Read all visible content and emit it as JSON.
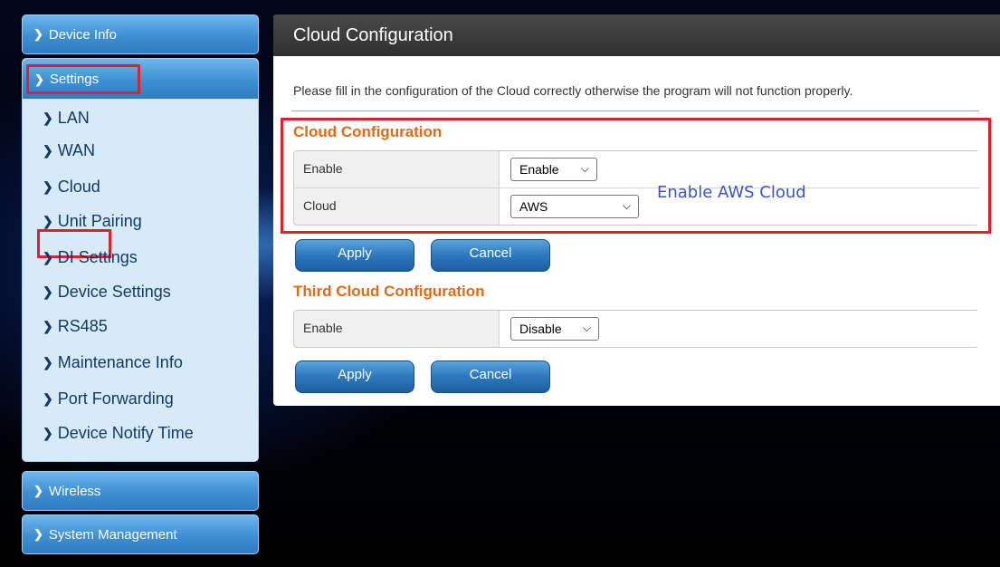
{
  "sidebar": {
    "device_info": "Device Info",
    "settings": "Settings",
    "settings_items": [
      "LAN",
      "WAN",
      "Cloud",
      "Unit Pairing",
      "DI Settings",
      "Device Settings",
      "RS485",
      "Maintenance Info",
      "Port Forwarding",
      "Device Notify Time"
    ],
    "wireless": "Wireless",
    "system_management": "System Management"
  },
  "main": {
    "title": "Cloud Configuration",
    "intro": "Please fill in the configuration of the Cloud correctly otherwise the program will not function properly.",
    "cloud_section": {
      "title": "Cloud Configuration",
      "enable_label": "Enable",
      "enable_value": "Enable",
      "cloud_label": "Cloud",
      "cloud_value": "AWS"
    },
    "third_section": {
      "title": "Third Cloud Configuration",
      "enable_label": "Enable",
      "enable_value": "Disable"
    },
    "apply_label": "Apply",
    "cancel_label": "Cancel",
    "annotation": "Enable AWS Cloud"
  },
  "icons": {
    "chevron": "chevron-right-icon",
    "caret": "chevron-down-icon"
  },
  "colors": {
    "accent_orange": "#e46a12",
    "highlight_red": "#e0202a",
    "annotation_blue": "#3b55c4"
  }
}
